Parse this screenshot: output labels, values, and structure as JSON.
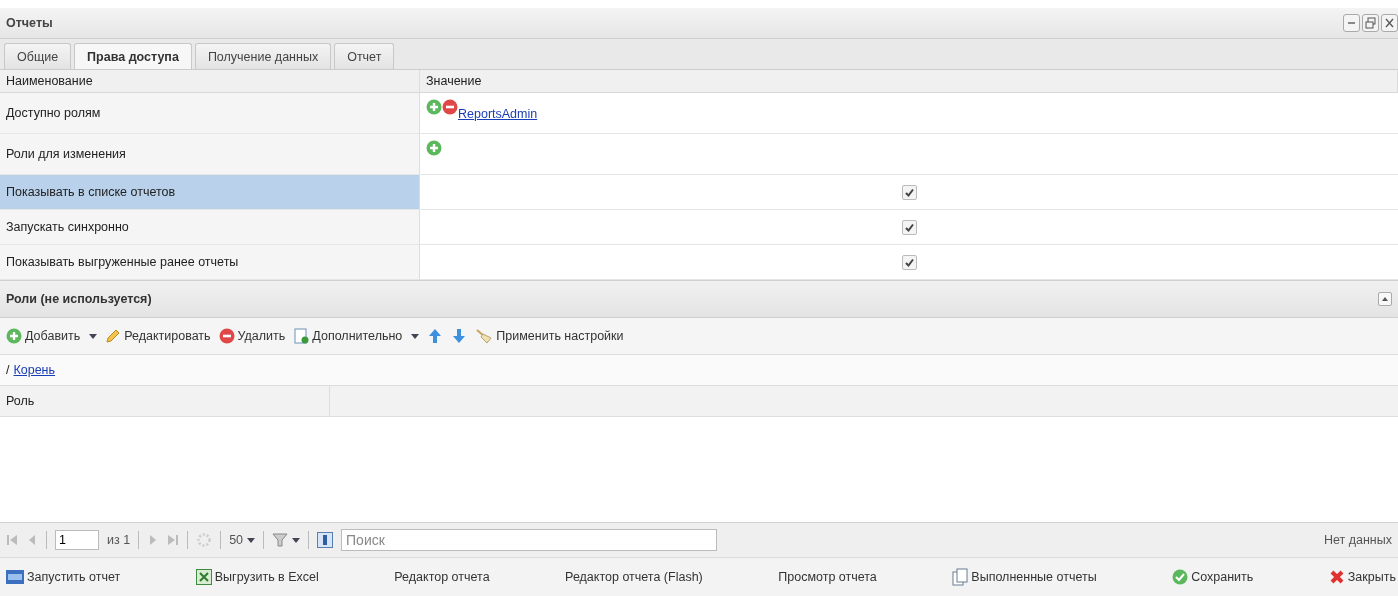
{
  "window": {
    "title": "Отчеты"
  },
  "tabs": [
    {
      "label": "Общие",
      "selected": false
    },
    {
      "label": "Права доступа",
      "selected": true
    },
    {
      "label": "Получение данных",
      "selected": false
    },
    {
      "label": "Отчет",
      "selected": false
    }
  ],
  "properties": {
    "columns": [
      "Наименование",
      "Значение"
    ],
    "rows": [
      {
        "kind": "roles",
        "name": "Доступно ролям",
        "selected": false,
        "roles": [
          "ReportsAdmin"
        ]
      },
      {
        "kind": "roles",
        "name": "Роли для изменения",
        "selected": false,
        "roles": []
      },
      {
        "kind": "checkbox",
        "name": "Показывать в списке отчетов",
        "selected": true,
        "checked": true
      },
      {
        "kind": "checkbox",
        "name": "Запускать синхронно",
        "selected": false,
        "checked": true
      },
      {
        "kind": "checkbox",
        "name": "Показывать выгруженные ранее отчеты",
        "selected": false,
        "checked": true
      }
    ]
  },
  "roles_panel": {
    "title": "Роли (не используется)",
    "toolbar": [
      {
        "kind": "add",
        "label": "Добавить",
        "dropdown": true
      },
      {
        "kind": "edit",
        "label": "Редактировать",
        "dropdown": false
      },
      {
        "kind": "delete",
        "label": "Удалить",
        "dropdown": false
      },
      {
        "kind": "more",
        "label": "Дополнительно",
        "dropdown": true
      },
      {
        "kind": "up",
        "dropdown": false
      },
      {
        "kind": "down",
        "dropdown": false
      },
      {
        "kind": "apply",
        "label": "Применить настройки",
        "dropdown": false
      }
    ],
    "breadcrumb": {
      "separator": "/",
      "link": "Корень"
    },
    "columns": [
      "Роль"
    ]
  },
  "paging": {
    "page": "1",
    "of": "из 1",
    "page_size": "50",
    "search_placeholder": "Поиск",
    "status": "Нет данных"
  },
  "footer": [
    {
      "kind": "html",
      "label": "Запустить отчет"
    },
    {
      "kind": "excel",
      "label": "Выгрузить в Excel"
    },
    {
      "kind": "plain",
      "label": "Редактор отчета"
    },
    {
      "kind": "plain",
      "label": "Редактор отчета (Flash)"
    },
    {
      "kind": "plain",
      "label": "Просмотр отчета"
    },
    {
      "kind": "docs",
      "label": "Выполненные отчеты"
    },
    {
      "kind": "save",
      "label": "Сохранить"
    },
    {
      "kind": "close",
      "label": "Закрыть"
    }
  ]
}
